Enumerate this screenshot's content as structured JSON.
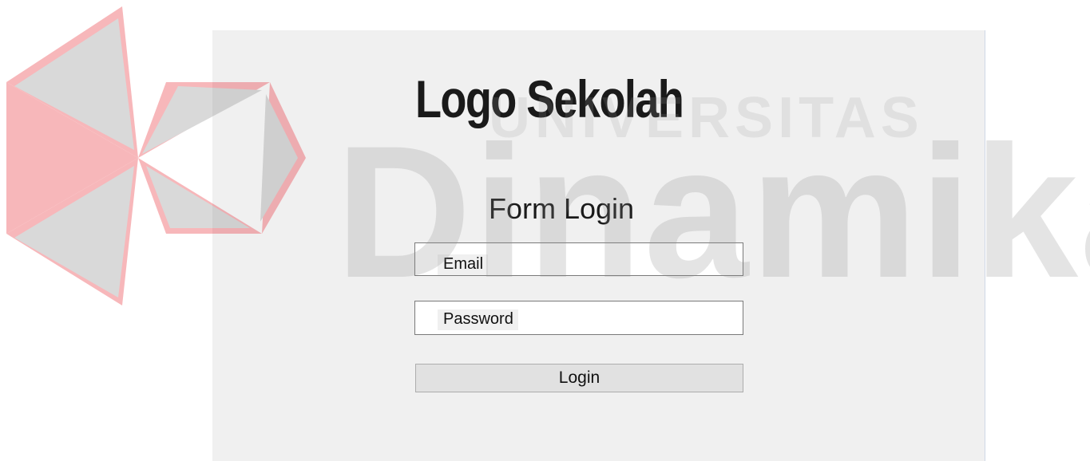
{
  "form": {
    "title": "Logo Sekolah",
    "subtitle": "Form Login",
    "email_label": "Email",
    "password_label": "Password",
    "login_label": "Login"
  },
  "watermark": {
    "top_text": "UNIVERSITAS",
    "main_text": "Dinamika",
    "logo_colors": [
      "#e8212b",
      "#9e9e9e"
    ]
  }
}
